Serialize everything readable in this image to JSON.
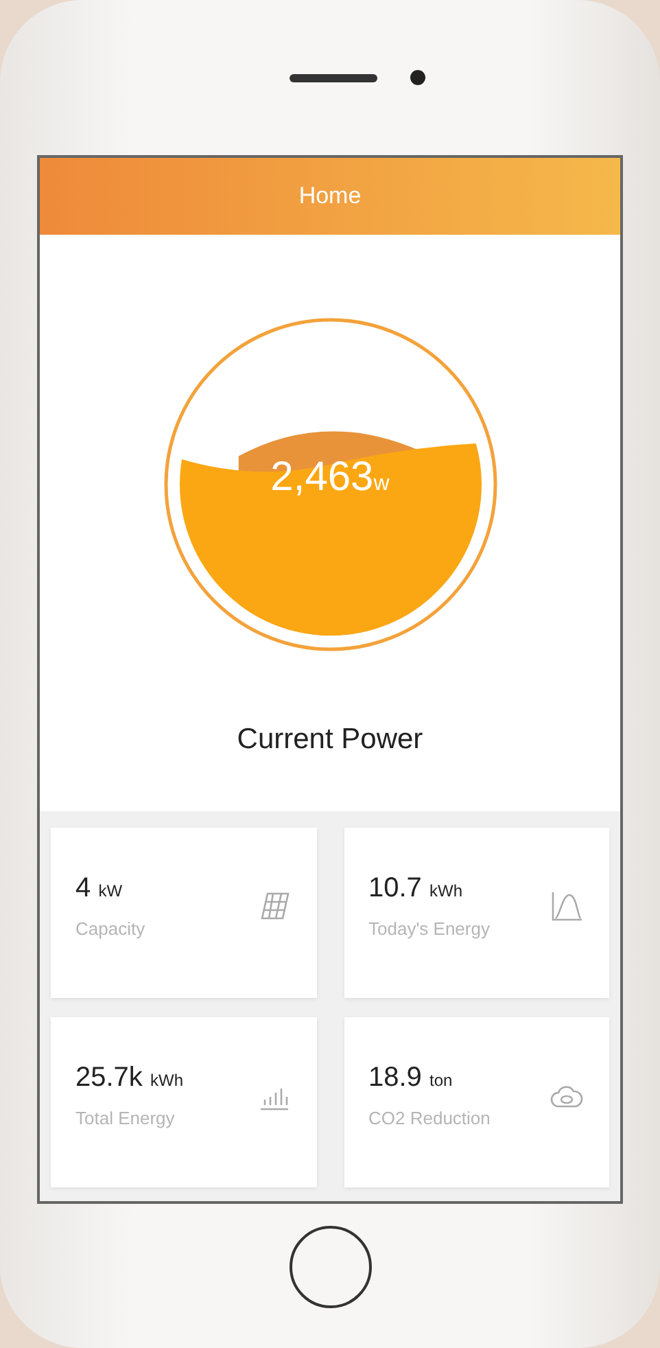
{
  "header": {
    "title": "Home"
  },
  "power": {
    "value": "2,463",
    "unit": "w",
    "label": "Current Power"
  },
  "stats": [
    {
      "kind": "panel",
      "value": "4",
      "unit": "kW",
      "label": "Capacity"
    },
    {
      "kind": "curve",
      "value": "10.7",
      "unit": "kWh",
      "label": "Today's Energy"
    },
    {
      "kind": "bars",
      "value": "25.7k",
      "unit": "kWh",
      "label": "Total Energy"
    },
    {
      "kind": "cloud",
      "value": "18.9",
      "unit": "ton",
      "label": "CO2 Reduction"
    }
  ]
}
